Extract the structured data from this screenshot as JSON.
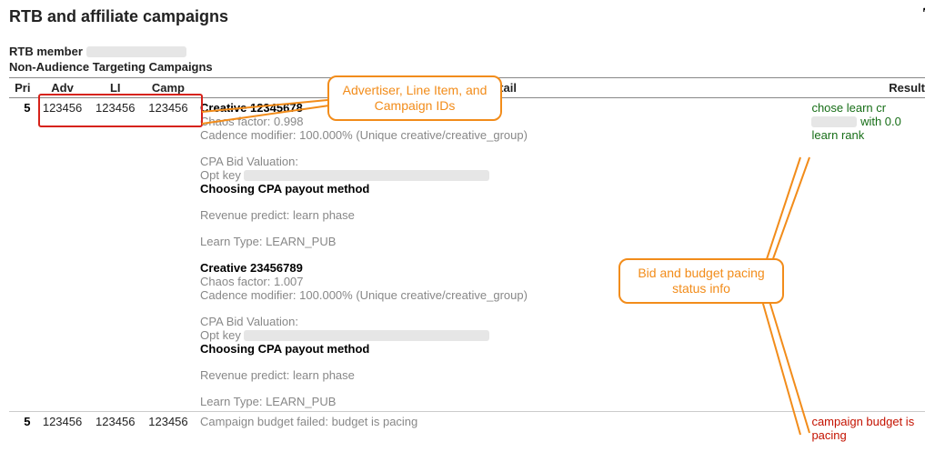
{
  "page_title": "RTB and affiliate campaigns",
  "member_label": "RTB member",
  "section_title": "Non-Audience Targeting Campaigns",
  "thead": {
    "pri": "Pri",
    "adv": "Adv",
    "li": "LI",
    "camp": "Camp",
    "detail": "Detail",
    "result": "Result"
  },
  "rows": [
    {
      "pri": "5",
      "adv": "123456",
      "li": "123456",
      "camp": "123456",
      "detail": {
        "creatives": [
          {
            "title": "Creative 12345678",
            "chaos": "Chaos factor: 0.998",
            "cadence": "Cadence modifier: 100.000% (Unique creative/creative_group)",
            "bid_label": "CPA Bid Valuation:",
            "opt_key_label": "Opt key",
            "choosing": "Choosing CPA payout method",
            "revenue": "Revenue predict: learn phase",
            "learn_type": "Learn Type: LEARN_PUB"
          },
          {
            "title": "Creative 23456789",
            "chaos": "Chaos factor: 1.007",
            "cadence": "Cadence modifier: 100.000% (Unique creative/creative_group)",
            "bid_label": "CPA Bid Valuation:",
            "opt_key_label": "Opt key",
            "choosing": "Choosing CPA payout method",
            "revenue": "Revenue predict: learn phase",
            "learn_type": "Learn Type: LEARN_PUB"
          }
        ]
      },
      "result": {
        "line1": "chose learn cr",
        "line2_suffix": "with 0.0",
        "line3": "learn rank"
      }
    },
    {
      "pri": "5",
      "adv": "123456",
      "li": "123456",
      "camp": "123456",
      "detail_plain": "Campaign budget failed: budget is pacing",
      "result_plain": "campaign budget is pacing"
    }
  ],
  "annotations": {
    "ids_callout": "Advertiser, Line Item, and Campaign IDs",
    "pacing_callout": "Bid and budget pacing status info"
  }
}
